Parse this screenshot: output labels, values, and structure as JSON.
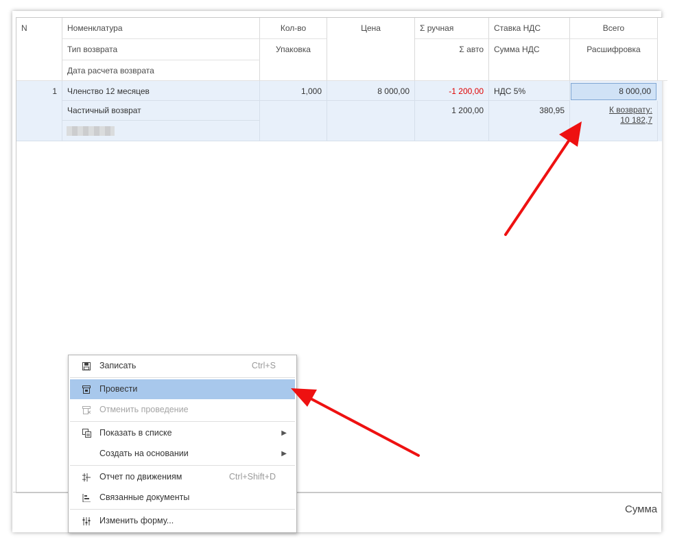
{
  "table": {
    "headers": {
      "n": "N",
      "nomenclature": "Номенклатура",
      "return_type": "Тип возврата",
      "return_date": "Дата расчета возврата",
      "qty": "Кол-во",
      "pack": "Упаковка",
      "price": "Цена",
      "sum_manual": "Σ ручная",
      "sum_auto": "Σ авто",
      "vat_rate": "Ставка НДС",
      "vat_sum": "Сумма НДС",
      "total": "Всего",
      "breakdown": "Расшифровка"
    },
    "rows": [
      {
        "n": "1",
        "nomenclature": "Членство 12 месяцев",
        "return_type": "Частичный возврат",
        "qty": "1,000",
        "price": "8 000,00",
        "sum_manual": "-1 200,00",
        "sum_auto": "1 200,00",
        "vat_rate": "НДС 5%",
        "vat_sum": "380,95",
        "total": "8 000,00",
        "breakdown_line1": "К возврату:",
        "breakdown_line2": "10 182,7"
      }
    ]
  },
  "footer": {
    "sum_label": "Сумма"
  },
  "context_menu": {
    "items": [
      {
        "label": "Записать",
        "shortcut": "Ctrl+S",
        "icon": "save-icon"
      },
      {
        "label": "Провести",
        "icon": "post-icon",
        "active": true
      },
      {
        "label": "Отменить проведение",
        "icon": "unpost-icon",
        "disabled": true
      },
      {
        "label": "Показать в списке",
        "icon": "show-list-icon",
        "submenu": true
      },
      {
        "label": "Создать на основании",
        "submenu": true
      },
      {
        "label": "Отчет по движениям",
        "shortcut": "Ctrl+Shift+D",
        "icon": "movements-report-icon"
      },
      {
        "label": "Связанные документы",
        "icon": "related-docs-icon"
      },
      {
        "label": "Изменить форму...",
        "icon": "form-settings-icon"
      }
    ]
  },
  "colors": {
    "accent_selected": "#a8c8ec",
    "row_highlight": "#e8f0fa",
    "negative": "#e00000",
    "annotation_arrow": "#ee1111"
  }
}
